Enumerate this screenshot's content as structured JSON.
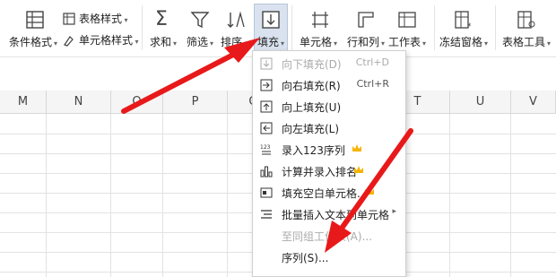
{
  "ribbon": {
    "cond_format": "条件格式",
    "table_style": "表格样式",
    "cell_style": "单元格样式",
    "sum": "求和",
    "filter": "筛选",
    "sort": "排序",
    "fill": "填充",
    "cell": "单元格",
    "rowcol": "行和列",
    "sheet": "工作表",
    "freeze": "冻结窗格",
    "table_tools": "表格工具"
  },
  "columns": [
    "M",
    "N",
    "O",
    "P",
    "Q",
    "R",
    "S",
    "T",
    "U",
    "V"
  ],
  "fill_menu": {
    "items": [
      {
        "label": "向下填充(D)",
        "shortcut": "Ctrl+D",
        "disabled": true
      },
      {
        "label": "向右填充(R)",
        "shortcut": "Ctrl+R",
        "disabled": false
      },
      {
        "label": "向上填充(U)",
        "shortcut": "",
        "disabled": false
      },
      {
        "label": "向左填充(L)",
        "shortcut": "",
        "disabled": false
      },
      {
        "label": "录入123序列",
        "shortcut": "",
        "disabled": false
      },
      {
        "label": "计算并录入排名",
        "shortcut": "",
        "disabled": false
      },
      {
        "label": "填充空白单元格...",
        "shortcut": "",
        "disabled": false
      },
      {
        "label": "批量插入文本到单元格",
        "shortcut": "",
        "disabled": false
      },
      {
        "label": "至同组工作表(A)...",
        "shortcut": "",
        "disabled": true
      },
      {
        "label": "序列(S)...",
        "shortcut": "",
        "disabled": false
      }
    ]
  },
  "colors": {
    "arrow": "#e8191a",
    "crown": "#f5b400",
    "active": "#d9e2ee"
  }
}
